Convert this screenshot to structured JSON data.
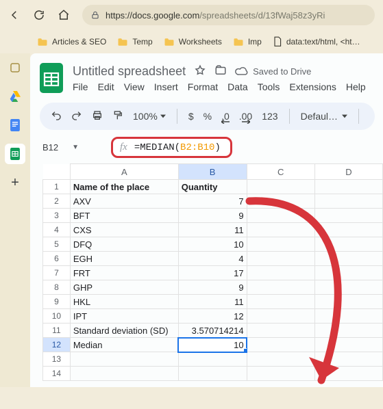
{
  "browser": {
    "url_host": "https://docs.google.com",
    "url_path": "/spreadsheets/d/13fWaj58z3yRi"
  },
  "bookmarks": [
    "Articles & SEO",
    "Temp",
    "Worksheets",
    "Imp",
    "data:text/html, <ht…"
  ],
  "doc": {
    "title": "Untitled spreadsheet",
    "saved": "Saved to Drive"
  },
  "menus": [
    "File",
    "Edit",
    "View",
    "Insert",
    "Format",
    "Data",
    "Tools",
    "Extensions",
    "Help"
  ],
  "toolbar": {
    "zoom": "100%",
    "dollar": "$",
    "percent": "%",
    "dec_dec": ".0",
    "dec_inc": ".00",
    "num123": "123",
    "font": "Defaul…"
  },
  "name_box": "B12",
  "formula": {
    "fn": "=MEDIAN",
    "open": "(",
    "range": "B2:B10",
    "close": ")"
  },
  "headers": [
    "A",
    "B",
    "C",
    "D"
  ],
  "chart_data": {
    "type": "table",
    "columns": [
      "Name of the place",
      "Quantity"
    ],
    "rows": [
      {
        "name": "AXV",
        "qty": 7
      },
      {
        "name": "BFT",
        "qty": 9
      },
      {
        "name": "CXS",
        "qty": 11
      },
      {
        "name": "DFQ",
        "qty": 10
      },
      {
        "name": "EGH",
        "qty": 4
      },
      {
        "name": "FRT",
        "qty": 17
      },
      {
        "name": "GHP",
        "qty": 9
      },
      {
        "name": "HKL",
        "qty": 11
      },
      {
        "name": "IPT",
        "qty": 12
      }
    ],
    "summary": [
      {
        "label": "Standard deviation (SD)",
        "value": "3.570714214"
      },
      {
        "label": "Median",
        "value": 10
      }
    ],
    "selection": {
      "cell": "B12",
      "row": 12,
      "col": "B"
    }
  }
}
